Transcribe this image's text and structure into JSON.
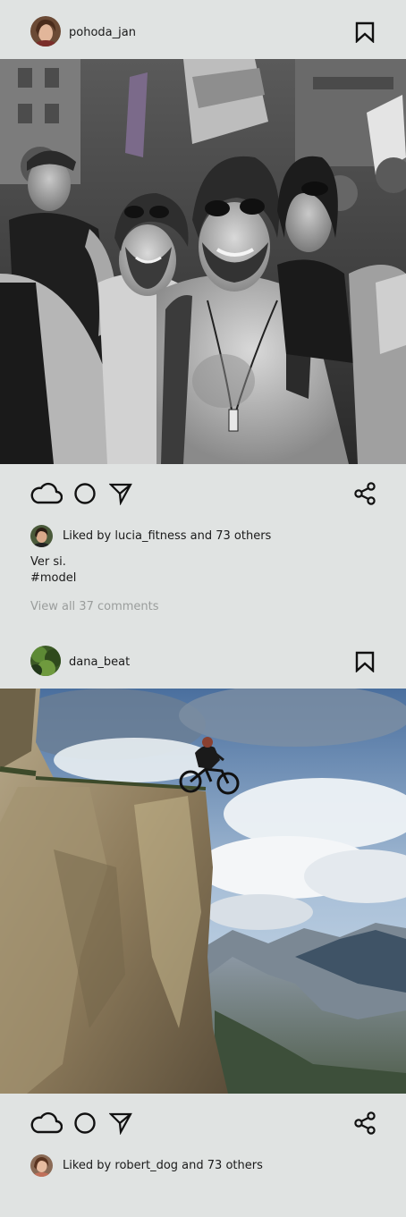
{
  "posts": [
    {
      "username": "pohoda_jan",
      "image_description": "black and white crowd photo, smiling men with sunglasses at a street parade",
      "liked_by": "Liked by lucia_fitness and 73 others",
      "caption_line1": "Ver si.",
      "caption_line2": "#model",
      "view_comments": "View all 37 comments",
      "icons": [
        "cloud-icon",
        "circle-icon",
        "send-icon",
        "share-icon",
        "bookmark-icon"
      ]
    },
    {
      "username": "dana_beat",
      "image_description": "mountain biker on the edge of a rocky cliff above a valley with clouds",
      "liked_by": "Liked by robert_dog and 73 others",
      "icons": [
        "cloud-icon",
        "circle-icon",
        "send-icon",
        "share-icon",
        "bookmark-icon"
      ]
    }
  ],
  "colors": {
    "background": "#e0e3e2",
    "text": "#1a1a1a",
    "muted": "#9a9d9c"
  }
}
